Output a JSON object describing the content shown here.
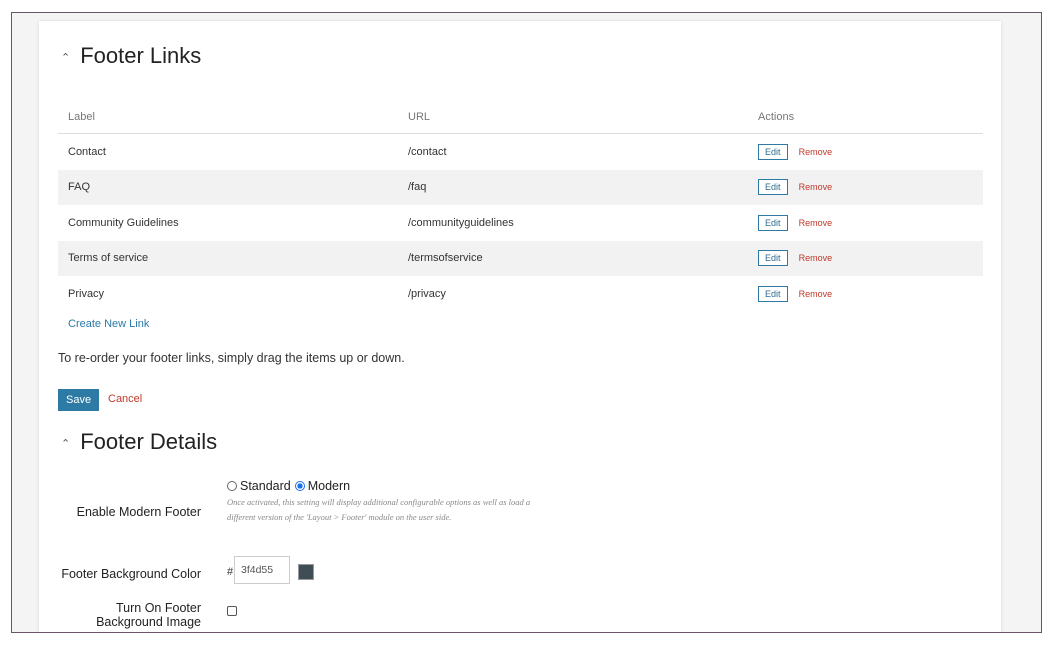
{
  "footer_links": {
    "title": "Footer Links",
    "columns": [
      "Label",
      "URL",
      "Actions"
    ],
    "rows": [
      {
        "label": "Contact",
        "url": "/contact"
      },
      {
        "label": "FAQ",
        "url": "/faq"
      },
      {
        "label": "Community Guidelines",
        "url": "/communityguidelines"
      },
      {
        "label": "Terms of service",
        "url": "/termsofservice"
      },
      {
        "label": "Privacy",
        "url": "/privacy"
      }
    ],
    "edit_label": "Edit",
    "remove_label": "Remove",
    "create_link": "Create New Link",
    "hint": "To re-order your footer links, simply drag the items up or down.",
    "save_label": "Save",
    "cancel_label": "Cancel"
  },
  "footer_details": {
    "title": "Footer Details",
    "modern_footer": {
      "label": "Enable Modern Footer",
      "options": [
        "Standard",
        "Modern"
      ],
      "selected": "Modern",
      "help": "Once activated, this setting will display additional configurable options as well as load a different version of the 'Layout > Footer' module on the user side."
    },
    "bg_color": {
      "label": "Footer Background Color",
      "prefix": "#",
      "value": "3f4d55",
      "swatch": "#3f4d55"
    },
    "bg_image": {
      "label": "Turn On Footer Background Image",
      "checked": false
    }
  },
  "colors": {
    "primary": "#2d7aa5",
    "danger": "#c0392b"
  }
}
